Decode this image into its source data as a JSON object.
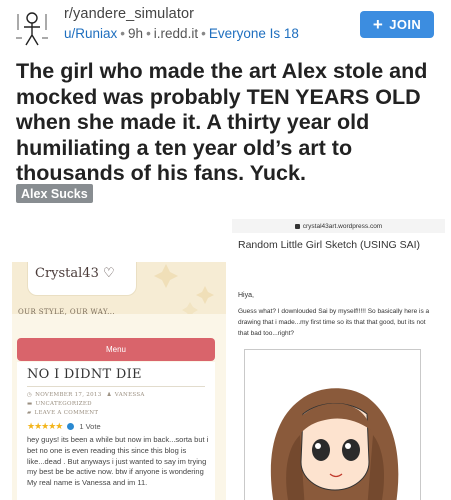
{
  "header": {
    "subreddit": "r/yandere_simulator",
    "user": "u/Runiax",
    "age": "9h",
    "domain": "i.redd.it",
    "flair": "Everyone Is 18",
    "join_label": "JOIN",
    "avatar_icon": "stick-figure-avatar-icon"
  },
  "post": {
    "title": "The girl who made the art Alex stole and mocked was probably TEN YEARS OLD when she made it. A thirty year old humiliating a ten year old’s art to thousands of his fans. Yuck.",
    "flair": "Alex Sucks"
  },
  "left_screenshot": {
    "blog_title": "Crystal43 ♡",
    "tagline": "OUR STYLE, OUR WAY...",
    "menu_label": "Menu",
    "post_title": "NO I DIDNT DIE",
    "meta_date": "NOVEMBER 17, 2013",
    "meta_author": "VANESSA",
    "meta_category": "UNCATEGORIZED",
    "meta_comment": "LEAVE A COMMENT",
    "rating_stars": "★★★★★",
    "rating_votes": "1 Vote",
    "body": "hey guys! its been a while but now im back...sorta but i bet no one is even reading this since this blog is like...dead . But anyways i just wanted to say im trying my best be be active now. btw if anyone is wondering My real name is Vanessa and im 11."
  },
  "right_screenshot": {
    "address": "crystal43art.wordpress.com",
    "post_title": "Random Little Girl Sketch (USING SAI)",
    "greeting": "Hiya,",
    "body": "Guess what? I downlouded Sai by myself!!!!! So basically here is a drawing that i made...my first time so its that that good, but its not that bad too...right?"
  },
  "colors": {
    "join_bg": "#3c8de0",
    "link_blue": "#1f6fbf",
    "flair_grey": "#888d91",
    "menu_red": "#d9646b",
    "blog_bg": "#fbf6e8"
  }
}
